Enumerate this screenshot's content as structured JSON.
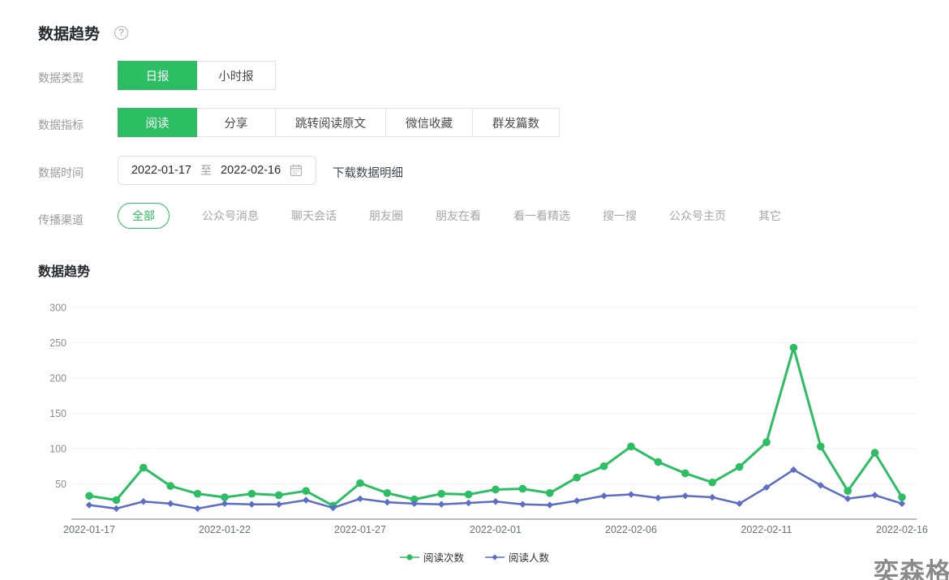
{
  "header": {
    "title": "数据趋势"
  },
  "filters": {
    "data_type": {
      "label": "数据类型",
      "options": [
        {
          "label": "日报",
          "selected": true
        },
        {
          "label": "小时报",
          "selected": false
        }
      ]
    },
    "data_metric": {
      "label": "数据指标",
      "options": [
        {
          "label": "阅读",
          "selected": true
        },
        {
          "label": "分享",
          "selected": false
        },
        {
          "label": "跳转阅读原文",
          "selected": false
        },
        {
          "label": "微信收藏",
          "selected": false
        },
        {
          "label": "群发篇数",
          "selected": false
        }
      ]
    },
    "data_time": {
      "label": "数据时间",
      "start_date": "2022-01-17",
      "separator": "至",
      "end_date": "2022-02-16",
      "download_label": "下载数据明细"
    },
    "channel": {
      "label": "传播渠道",
      "options": [
        {
          "label": "全部",
          "selected": true
        },
        {
          "label": "公众号消息",
          "selected": false
        },
        {
          "label": "聊天会话",
          "selected": false
        },
        {
          "label": "朋友圈",
          "selected": false
        },
        {
          "label": "朋友在看",
          "selected": false
        },
        {
          "label": "看一看精选",
          "selected": false
        },
        {
          "label": "搜一搜",
          "selected": false
        },
        {
          "label": "公众号主页",
          "selected": false
        },
        {
          "label": "其它",
          "selected": false
        }
      ]
    }
  },
  "chart_section": {
    "title": "数据趋势"
  },
  "watermark": "奕森格",
  "colors": {
    "accent_green": "#2BBE62",
    "line_green": "#2BBE62",
    "line_blue": "#5B6CC9",
    "axis_line": "#b6bcc2",
    "grid_line": "#f0f2f5",
    "y_label": "#8f8f8f",
    "x_label": "#6E7079"
  },
  "chart_data": {
    "type": "line",
    "title": "数据趋势",
    "x": [
      "2022-01-17",
      "2022-01-18",
      "2022-01-19",
      "2022-01-20",
      "2022-01-21",
      "2022-01-22",
      "2022-01-23",
      "2022-01-24",
      "2022-01-25",
      "2022-01-26",
      "2022-01-27",
      "2022-01-28",
      "2022-01-29",
      "2022-01-30",
      "2022-01-31",
      "2022-02-01",
      "2022-02-02",
      "2022-02-03",
      "2022-02-04",
      "2022-02-05",
      "2022-02-06",
      "2022-02-07",
      "2022-02-08",
      "2022-02-09",
      "2022-02-10",
      "2022-02-11",
      "2022-02-12",
      "2022-02-13",
      "2022-02-14",
      "2022-02-15",
      "2022-02-16"
    ],
    "series": [
      {
        "name": "阅读次数",
        "color": "#2BBE62",
        "marker": "circle",
        "values": [
          33,
          27,
          73,
          47,
          36,
          31,
          36,
          34,
          40,
          19,
          51,
          37,
          28,
          36,
          35,
          42,
          43,
          37,
          59,
          75,
          103,
          81,
          65,
          52,
          74,
          109,
          243,
          103,
          40,
          94,
          31
        ]
      },
      {
        "name": "阅读人数",
        "color": "#5B6CC9",
        "marker": "diamond",
        "values": [
          20,
          15,
          25,
          22,
          15,
          22,
          21,
          21,
          27,
          16,
          29,
          24,
          22,
          21,
          23,
          25,
          21,
          20,
          26,
          33,
          35,
          30,
          33,
          31,
          22,
          45,
          70,
          48,
          29,
          34,
          22
        ]
      }
    ],
    "xlabel": "",
    "ylabel": "",
    "ylim": [
      0,
      300
    ],
    "y_ticks": [
      50,
      100,
      150,
      200,
      250,
      300
    ],
    "x_tick_every": 5,
    "grid": true,
    "legend_position": "bottom"
  }
}
